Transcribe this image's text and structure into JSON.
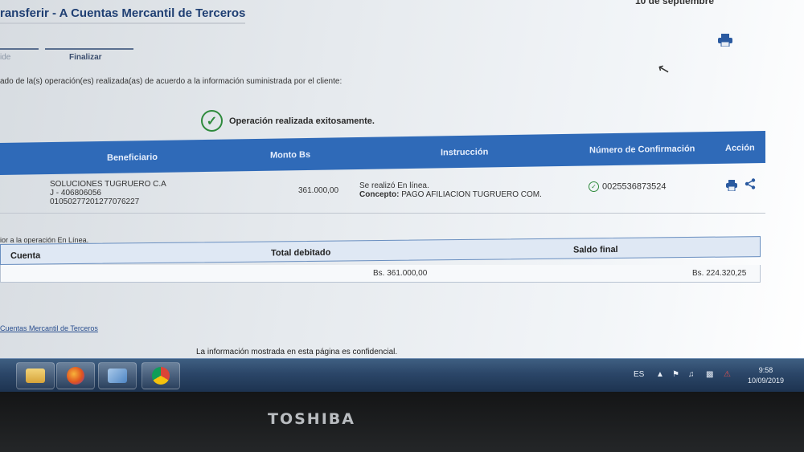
{
  "header": {
    "title": "ransferir - A Cuentas Mercantil de Terceros",
    "date_partial": "10 de septiembre"
  },
  "steps": {
    "prev_label": "ide",
    "current_label": "Finalizar"
  },
  "intro_text": "ado de la(s) operación(es) realizada(as) de acuerdo a la información suministrada por el cliente:",
  "success_message": "Operación realizada exitosamente.",
  "operations_table": {
    "headers": {
      "beneficiary": "Beneficiario",
      "amount": "Monto Bs",
      "instruction": "Instrucción",
      "confirmation": "Número de Confirmación",
      "action": "Acción"
    },
    "row": {
      "beneficiary_name": "SOLUCIONES TUGRUERO C.A",
      "beneficiary_id": "J - 406806056",
      "beneficiary_account": "01050277201277076227",
      "amount": "361.000,00",
      "instruction_status": "Se realizó En línea.",
      "concept_label": "Concepto:",
      "concept_value": "PAGO AFILIACION TUGRUERO COM.",
      "confirmation_number": "0025536873524"
    }
  },
  "online_note": "ior a la operación En Línea.",
  "summary_table": {
    "headers": {
      "account": "Cuenta",
      "total_debited": "Total debitado",
      "final_balance": "Saldo final"
    },
    "row": {
      "total_debited": "Bs. 361.000,00",
      "final_balance": "Bs. 224.320,25"
    }
  },
  "back_link": "Cuentas Mercantil de Terceros",
  "footer_note": "La información mostrada en esta página es confidencial.",
  "taskbar": {
    "language": "ES",
    "time": "9:58",
    "date": "10/09/2019"
  },
  "brand": "TOSHIBA",
  "icons": [
    "print-icon",
    "mouse-cursor-icon",
    "success-check-icon",
    "confirmation-check-icon",
    "share-icon",
    "firefox-icon",
    "chrome-icon",
    "folder-icon"
  ]
}
